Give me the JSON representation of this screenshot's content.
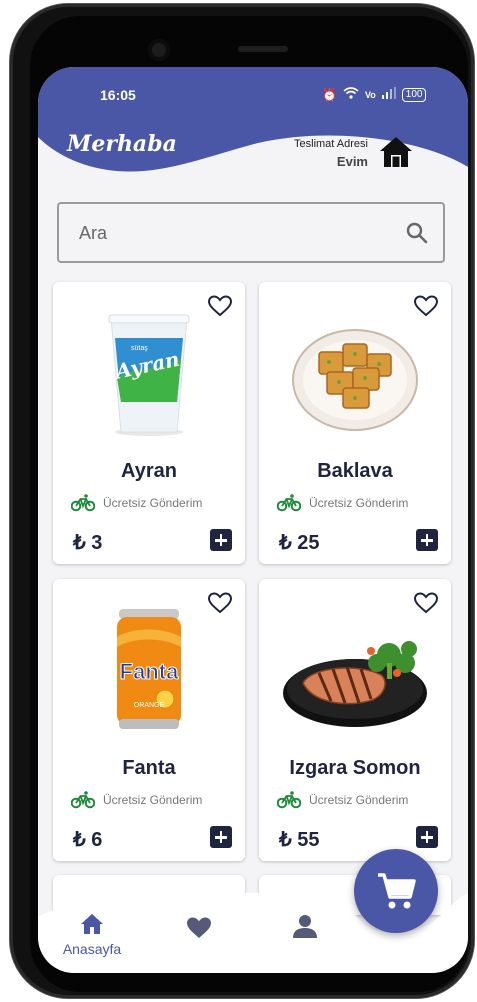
{
  "status_bar": {
    "time": "16:05",
    "icons": [
      "alarm-icon",
      "wifi-icon",
      "volte-icon",
      "signal-icon"
    ],
    "battery": "100"
  },
  "header": {
    "greeting": "Merhaba",
    "address_label": "Teslimat Adresi",
    "address_value": "Evim",
    "address_icon": "house-icon"
  },
  "search": {
    "placeholder": "Ara",
    "icon": "search-icon"
  },
  "products": [
    {
      "name": "Ayran",
      "delivery": "Ücretsiz Gönderim",
      "price": "₺ 3",
      "image": "ayran-cup-image"
    },
    {
      "name": "Baklava",
      "delivery": "Ücretsiz Gönderim",
      "price": "₺ 25",
      "image": "baklava-plate-image"
    },
    {
      "name": "Fanta",
      "delivery": "Ücretsiz Gönderim",
      "price": "₺ 6",
      "image": "fanta-can-image"
    },
    {
      "name": "Izgara Somon",
      "delivery": "Ücretsiz Gönderim",
      "price": "₺ 55",
      "image": "grilled-salmon-image"
    }
  ],
  "bottom_nav": {
    "items": [
      {
        "label": "Anasayfa",
        "icon": "home-icon",
        "active": true
      },
      {
        "label": "",
        "icon": "heart-icon",
        "active": false
      },
      {
        "label": "",
        "icon": "person-icon",
        "active": false
      }
    ]
  },
  "fab": {
    "icon": "cart-icon"
  },
  "colors": {
    "primary": "#4a57a6",
    "dark_text": "#1f2440",
    "bike_green": "#1f8a3a",
    "background": "#f4f4f6"
  }
}
